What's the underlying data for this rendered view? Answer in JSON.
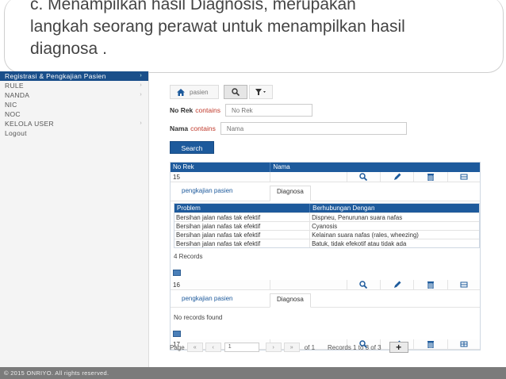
{
  "slide": {
    "line1": "c. Menampilkan hasil Diagnosis, merupakan",
    "line2": "langkah seorang perawat untuk menampilkan hasil",
    "line3": "diagnosa ."
  },
  "sidebar": {
    "items": [
      {
        "label": "Registrasi & Pengkajian Pasien",
        "arrow": "›"
      },
      {
        "label": "RULE",
        "arrow": "›"
      },
      {
        "label": "NANDA",
        "arrow": "›"
      },
      {
        "label": "NIC",
        "arrow": ""
      },
      {
        "label": "NOC",
        "arrow": ""
      },
      {
        "label": "KELOLA USER",
        "arrow": "›"
      },
      {
        "label": "Logout",
        "arrow": ""
      }
    ]
  },
  "toolbar": {
    "home_label": "pasien"
  },
  "search_form": {
    "norek_label": "No Rek",
    "norek_op": "contains",
    "norek_placeholder": "No Rek",
    "nama_label": "Nama",
    "nama_op": "contains",
    "nama_placeholder": "Nama",
    "search_label": "Search"
  },
  "grid": {
    "columns": [
      "No Rek",
      "Nama"
    ],
    "rows": [
      {
        "no_rek": "15",
        "nama": ""
      },
      {
        "no_rek": "16",
        "nama": ""
      },
      {
        "no_rek": "17",
        "nama": ""
      }
    ],
    "sub_tabs": [
      "pengkajian pasien",
      "Diagnosa"
    ]
  },
  "diagnosa": {
    "columns": [
      "Problem",
      "Berhubungan Dengan"
    ],
    "rows": [
      {
        "problem": "Bersihan jalan nafas tak efektif",
        "dengan": "Dispneu, Penurunan suara nafas"
      },
      {
        "problem": "Bersihan jalan nafas tak efektif",
        "dengan": "Cyanosis"
      },
      {
        "problem": "Bersihan jalan nafas tak efektif",
        "dengan": "Kelainan suara nafas (rales, wheezing)"
      },
      {
        "problem": "Bersihan jalan nafas tak efektif",
        "dengan": "Batuk, tidak efekotif atau tidak ada"
      }
    ],
    "records_label": "4 Records",
    "empty_label": "No records found"
  },
  "pager": {
    "page_label": "Page",
    "page_value": "1",
    "of_label": "of 1",
    "records_info": "Records 1 to 3 of 3"
  },
  "footer": {
    "text": "© 2015 ONRIYO. All rights reserved."
  },
  "colors": {
    "accent": "#1d5a9c",
    "sidebar_active": "#1a4f8a",
    "footer": "#7b7b7b"
  }
}
